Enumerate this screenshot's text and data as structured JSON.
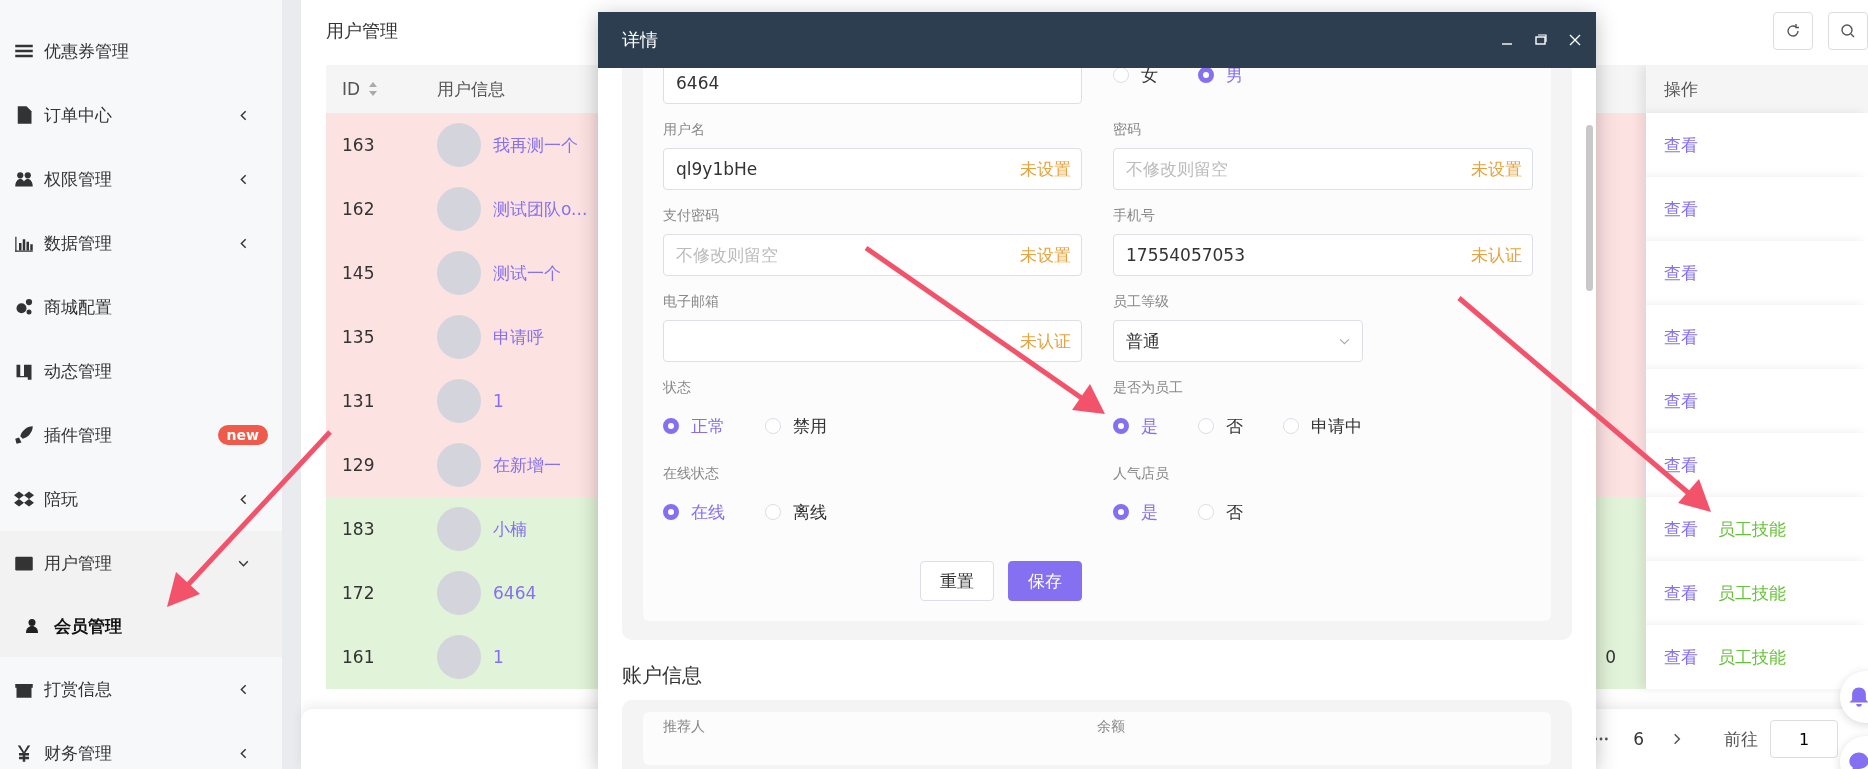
{
  "sidebar": {
    "items": [
      {
        "label": "优惠券管理",
        "expandable": false
      },
      {
        "label": "订单中心",
        "expandable": true,
        "expanded": false
      },
      {
        "label": "权限管理",
        "expandable": true,
        "expanded": false
      },
      {
        "label": "数据管理",
        "expandable": true,
        "expanded": false
      },
      {
        "label": "商城配置",
        "expandable": false
      },
      {
        "label": "动态管理",
        "expandable": false
      },
      {
        "label": "插件管理",
        "expandable": false,
        "badge": "new"
      },
      {
        "label": "陪玩",
        "expandable": true,
        "expanded": false
      },
      {
        "label": "用户管理",
        "expandable": true,
        "expanded": true,
        "children": [
          {
            "label": "会员管理",
            "selected": true
          }
        ]
      },
      {
        "label": "打赏信息",
        "expandable": true,
        "expanded": false
      },
      {
        "label": "财务管理",
        "expandable": true,
        "expanded": false
      }
    ]
  },
  "page": {
    "title": "用户管理"
  },
  "table": {
    "columns": [
      {
        "label": "ID",
        "sortable": true
      },
      {
        "label": "用户信息",
        "sortable": false
      },
      {
        "label": "操作",
        "sortable": false
      }
    ],
    "rows": [
      {
        "id": "163",
        "name": "我再测一个",
        "color": "#fde2e2",
        "actions": [
          {
            "label": "查看",
            "kind": "view"
          }
        ]
      },
      {
        "id": "162",
        "name": "测试团队o...",
        "color": "#fde2e2",
        "actions": [
          {
            "label": "查看",
            "kind": "view"
          }
        ]
      },
      {
        "id": "145",
        "name": "测试一个",
        "color": "#fde2e2",
        "actions": [
          {
            "label": "查看",
            "kind": "view"
          }
        ]
      },
      {
        "id": "135",
        "name": "申请呼",
        "color": "#fde2e2",
        "actions": [
          {
            "label": "查看",
            "kind": "view"
          }
        ]
      },
      {
        "id": "131",
        "name": "1",
        "color": "#fde2e2",
        "actions": [
          {
            "label": "查看",
            "kind": "view"
          }
        ]
      },
      {
        "id": "129",
        "name": "在新增一",
        "color": "#fde2e2",
        "actions": [
          {
            "label": "查看",
            "kind": "view"
          }
        ]
      },
      {
        "id": "183",
        "name": "小楠",
        "color": "#e1f3d8",
        "actions": [
          {
            "label": "查看",
            "kind": "view"
          },
          {
            "label": "员工技能",
            "kind": "skill"
          }
        ]
      },
      {
        "id": "172",
        "name": "6464",
        "color": "#e1f3d8",
        "actions": [
          {
            "label": "查看",
            "kind": "view"
          },
          {
            "label": "员工技能",
            "kind": "skill"
          }
        ]
      },
      {
        "id": "161",
        "name": "1",
        "color": "#e1f3d8",
        "column_3": "0",
        "actions": [
          {
            "label": "查看",
            "kind": "view"
          },
          {
            "label": "员工技能",
            "kind": "skill"
          }
        ]
      }
    ]
  },
  "pagination": {
    "page": "6",
    "goto_label": "前往",
    "goto_value": "1"
  },
  "dialog": {
    "title": "详情",
    "fields": [
      {
        "kind": "input",
        "value": "6464"
      },
      {
        "kind": "radio",
        "options": [
          {
            "label": "女",
            "selected": false
          },
          {
            "label": "男",
            "selected": true
          }
        ]
      },
      {
        "kind": "input",
        "label": "用户名",
        "value": "ql9y1bHe",
        "suffix": "未设置"
      },
      {
        "kind": "input",
        "label": "密码",
        "placeholder": "不修改则留空",
        "suffix": "未设置"
      },
      {
        "kind": "input",
        "label": "支付密码",
        "placeholder": "不修改则留空",
        "suffix": "未设置"
      },
      {
        "kind": "input",
        "label": "手机号",
        "value": "17554057053",
        "suffix": "未认证"
      },
      {
        "kind": "input",
        "label": "电子邮箱",
        "suffix": "未认证"
      },
      {
        "kind": "select",
        "label": "员工等级",
        "value": "普通"
      },
      {
        "kind": "radio",
        "label": "状态",
        "options": [
          {
            "label": "正常",
            "selected": true
          },
          {
            "label": "禁用",
            "selected": false
          }
        ]
      },
      {
        "kind": "radio",
        "label": "是否为员工",
        "options": [
          {
            "label": "是",
            "selected": true
          },
          {
            "label": "否",
            "selected": false
          },
          {
            "label": "申请中",
            "selected": false
          }
        ]
      },
      {
        "kind": "radio",
        "label": "在线状态",
        "options": [
          {
            "label": "在线",
            "selected": true
          },
          {
            "label": "离线",
            "selected": false
          }
        ]
      },
      {
        "kind": "radio",
        "label": "人气店员",
        "options": [
          {
            "label": "是",
            "selected": true
          },
          {
            "label": "否",
            "selected": false
          }
        ]
      }
    ],
    "buttons": [
      {
        "label": "重置",
        "kind": "default"
      },
      {
        "label": "保存",
        "kind": "primary"
      }
    ],
    "section": {
      "title": "账户信息",
      "fields": [
        {
          "label": "推荐人"
        },
        {
          "label": "余额"
        }
      ]
    }
  }
}
